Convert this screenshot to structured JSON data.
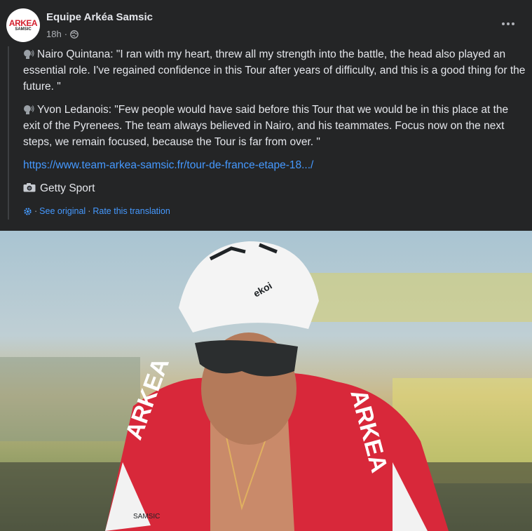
{
  "post": {
    "page_name": "Equipe Arkéa Samsic",
    "avatar_text_top": "ARKEA",
    "avatar_text_bottom": "SAMSIC",
    "timestamp": "18h",
    "timestamp_separator": "·",
    "paragraphs": [
      "Nairo Quintana: \"I ran with my heart, threw all my strength into the battle, the head also played an essential role. I've regained confidence in this Tour after years of difficulty, and this is a good thing for the future. \"",
      "Yvon Ledanois: \"Few people would have said before this Tour that we would be in this place at the exit of the Pyrenees. The team always believed in Nairo, and his teammates. Focus now on the next steps, we remain focused, because the Tour is far from over. \""
    ],
    "link": "https://www.team-arkea-samsic.fr/tour-de-france-etape-18.../",
    "photo_credit": "Getty Sport",
    "see_original": "See original",
    "rate_translation": "Rate this translation",
    "dot_separator": "·"
  },
  "icons": {
    "speech": "speaking-head-icon",
    "camera": "camera-icon",
    "globe": "globe-icon",
    "gear": "gear-icon",
    "more": "more-icon"
  },
  "photo": {
    "jersey_text": "ARKEA",
    "helmet_text": "ekoi",
    "cuff_text": "SAMSIC"
  },
  "colors": {
    "background": "#242526",
    "link": "#4599ff",
    "secondary_text": "#b0b3b8",
    "jersey_red": "#d8283a"
  }
}
